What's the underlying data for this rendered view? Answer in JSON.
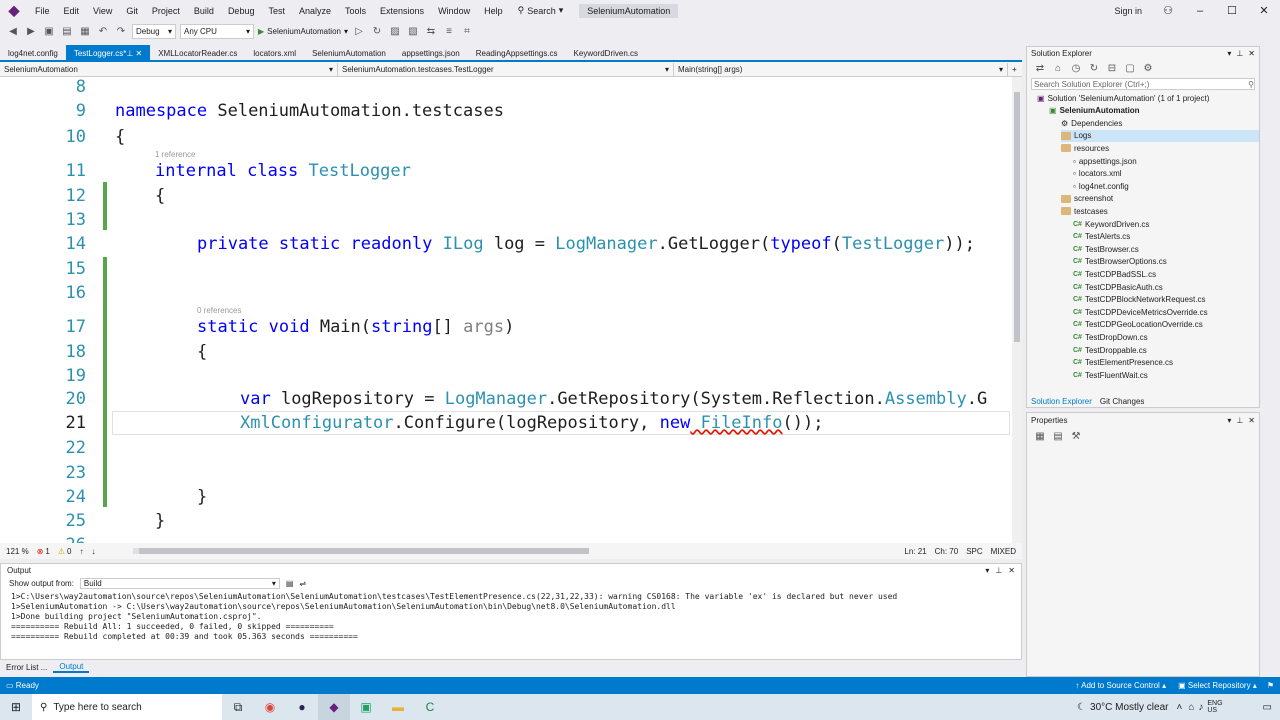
{
  "app": {
    "logo_char": "◆"
  },
  "menu": [
    "File",
    "Edit",
    "View",
    "Git",
    "Project",
    "Build",
    "Debug",
    "Test",
    "Analyze",
    "Tools",
    "Extensions",
    "Window",
    "Help"
  ],
  "search_label": "Search",
  "solution_name": "SeleniumAutomation",
  "sign_in": "Sign in",
  "toolbar": {
    "config": "Debug",
    "platform": "Any CPU",
    "run_target": "SeleniumAutomation"
  },
  "tabs": [
    "log4net.config",
    "TestLogger.cs*",
    "XMLLocatorReader.cs",
    "locators.xml",
    "SeleniumAutomation",
    "appsettings.json",
    "ReadingAppsettings.cs",
    "KeywordDriven.cs"
  ],
  "navbar": {
    "project": "SeleniumAutomation",
    "class": "SeleniumAutomation.testcases.TestLogger",
    "member": "Main(string[] args)"
  },
  "code": {
    "line_numbers": [
      "8",
      "9",
      "10",
      "11",
      "12",
      "13",
      "14",
      "15",
      "16",
      "17",
      "18",
      "19",
      "20",
      "21",
      "22",
      "23",
      "24",
      "25",
      "26"
    ],
    "ref1": "1 reference",
    "ref0": "0 references",
    "l9_kw": "namespace",
    "l9_name": " SeleniumAutomation.testcases",
    "l10": "{",
    "l11_kw": "internal class",
    "l11_type": " TestLogger",
    "l12": "{",
    "l14_kw": "private static readonly",
    "l14_type": " ILog",
    "l14_a": " log = ",
    "l14_type2": "LogManager",
    "l14_b": ".GetLogger(",
    "l14_kw2": "typeof",
    "l14_c": "(",
    "l14_type3": "TestLogger",
    "l14_d": "));",
    "l17_kw": "static void",
    "l17_a": " Main(",
    "l17_kw2": "string",
    "l17_b": "[] ",
    "l17_gr": "args",
    "l17_c": ")",
    "l18": "{",
    "l20_kw": "var",
    "l20_a": " logRepository = ",
    "l20_type": "LogManager",
    "l20_b": ".GetRepository(System.Reflection.",
    "l20_type2": "Assembly",
    "l20_c": ".G",
    "l21_type": "XmlConfigurator",
    "l21_a": ".Configure(logRepository, ",
    "l21_kw": "new",
    "l21_type2": " FileInfo",
    "l21_b": "());",
    "l24": "}",
    "l25": "}"
  },
  "editor_status": {
    "zoom": "121 %",
    "errors": "1",
    "warnings": "0",
    "ln": "Ln: 21",
    "ch": "Ch: 70",
    "spc": "SPC",
    "mixed": "MIXED"
  },
  "output": {
    "title": "Output",
    "show_from_label": "Show output from:",
    "show_from_value": "Build",
    "lines": [
      "1>C:\\Users\\way2automation\\source\\repos\\SeleniumAutomation\\SeleniumAutomation\\testcases\\TestElementPresence.cs(22,31,22,33): warning CS0168: The variable 'ex' is declared but never used",
      "1>SeleniumAutomation -> C:\\Users\\way2automation\\source\\repos\\SeleniumAutomation\\SeleniumAutomation\\bin\\Debug\\net8.0\\SeleniumAutomation.dll",
      "1>Done building project \"SeleniumAutomation.csproj\".",
      "========== Rebuild All: 1 succeeded, 0 failed, 0 skipped ==========",
      "========== Rebuild completed at 00:39 and took 05.363 seconds =========="
    ]
  },
  "bottom_tabs": [
    "Error List ...",
    "Output"
  ],
  "solution_explorer": {
    "title": "Solution Explorer",
    "search_placeholder": "Search Solution Explorer (Ctrl+;)",
    "items": [
      {
        "label": "Solution 'SeleniumAutomation' (1 of 1 project)",
        "indent": 0,
        "kind": "solution"
      },
      {
        "label": "SeleniumAutomation",
        "indent": 1,
        "kind": "project"
      },
      {
        "label": "Dependencies",
        "indent": 2,
        "kind": "deps"
      },
      {
        "label": "Logs",
        "indent": 2,
        "kind": "folder"
      },
      {
        "label": "resources",
        "indent": 2,
        "kind": "folder"
      },
      {
        "label": "appsettings.json",
        "indent": 3,
        "kind": "file"
      },
      {
        "label": "locators.xml",
        "indent": 3,
        "kind": "file"
      },
      {
        "label": "log4net.config",
        "indent": 3,
        "kind": "file"
      },
      {
        "label": "screenshot",
        "indent": 2,
        "kind": "folder"
      },
      {
        "label": "testcases",
        "indent": 2,
        "kind": "folder"
      },
      {
        "label": "KeywordDriven.cs",
        "indent": 3,
        "kind": "cs"
      },
      {
        "label": "TestAlerts.cs",
        "indent": 3,
        "kind": "cs"
      },
      {
        "label": "TestBrowser.cs",
        "indent": 3,
        "kind": "cs"
      },
      {
        "label": "TestBrowserOptions.cs",
        "indent": 3,
        "kind": "cs"
      },
      {
        "label": "TestCDPBadSSL.cs",
        "indent": 3,
        "kind": "cs"
      },
      {
        "label": "TestCDPBasicAuth.cs",
        "indent": 3,
        "kind": "cs"
      },
      {
        "label": "TestCDPBlockNetworkRequest.cs",
        "indent": 3,
        "kind": "cs"
      },
      {
        "label": "TestCDPDeviceMetricsOverride.cs",
        "indent": 3,
        "kind": "cs"
      },
      {
        "label": "TestCDPGeoLocationOverride.cs",
        "indent": 3,
        "kind": "cs"
      },
      {
        "label": "TestDropDown.cs",
        "indent": 3,
        "kind": "cs"
      },
      {
        "label": "TestDroppable.cs",
        "indent": 3,
        "kind": "cs"
      },
      {
        "label": "TestElementPresence.cs",
        "indent": 3,
        "kind": "cs"
      },
      {
        "label": "TestFluentWait.cs",
        "indent": 3,
        "kind": "cs"
      }
    ],
    "tabs": [
      "Solution Explorer",
      "Git Changes"
    ]
  },
  "properties": {
    "title": "Properties"
  },
  "statusbar": {
    "ready": "Ready",
    "source_control": "Add to Source Control",
    "repo": "Select Repository"
  },
  "taskbar": {
    "search_placeholder": "Type here to search",
    "weather": "30°C  Mostly clear",
    "lang": "ENG\nUS"
  }
}
